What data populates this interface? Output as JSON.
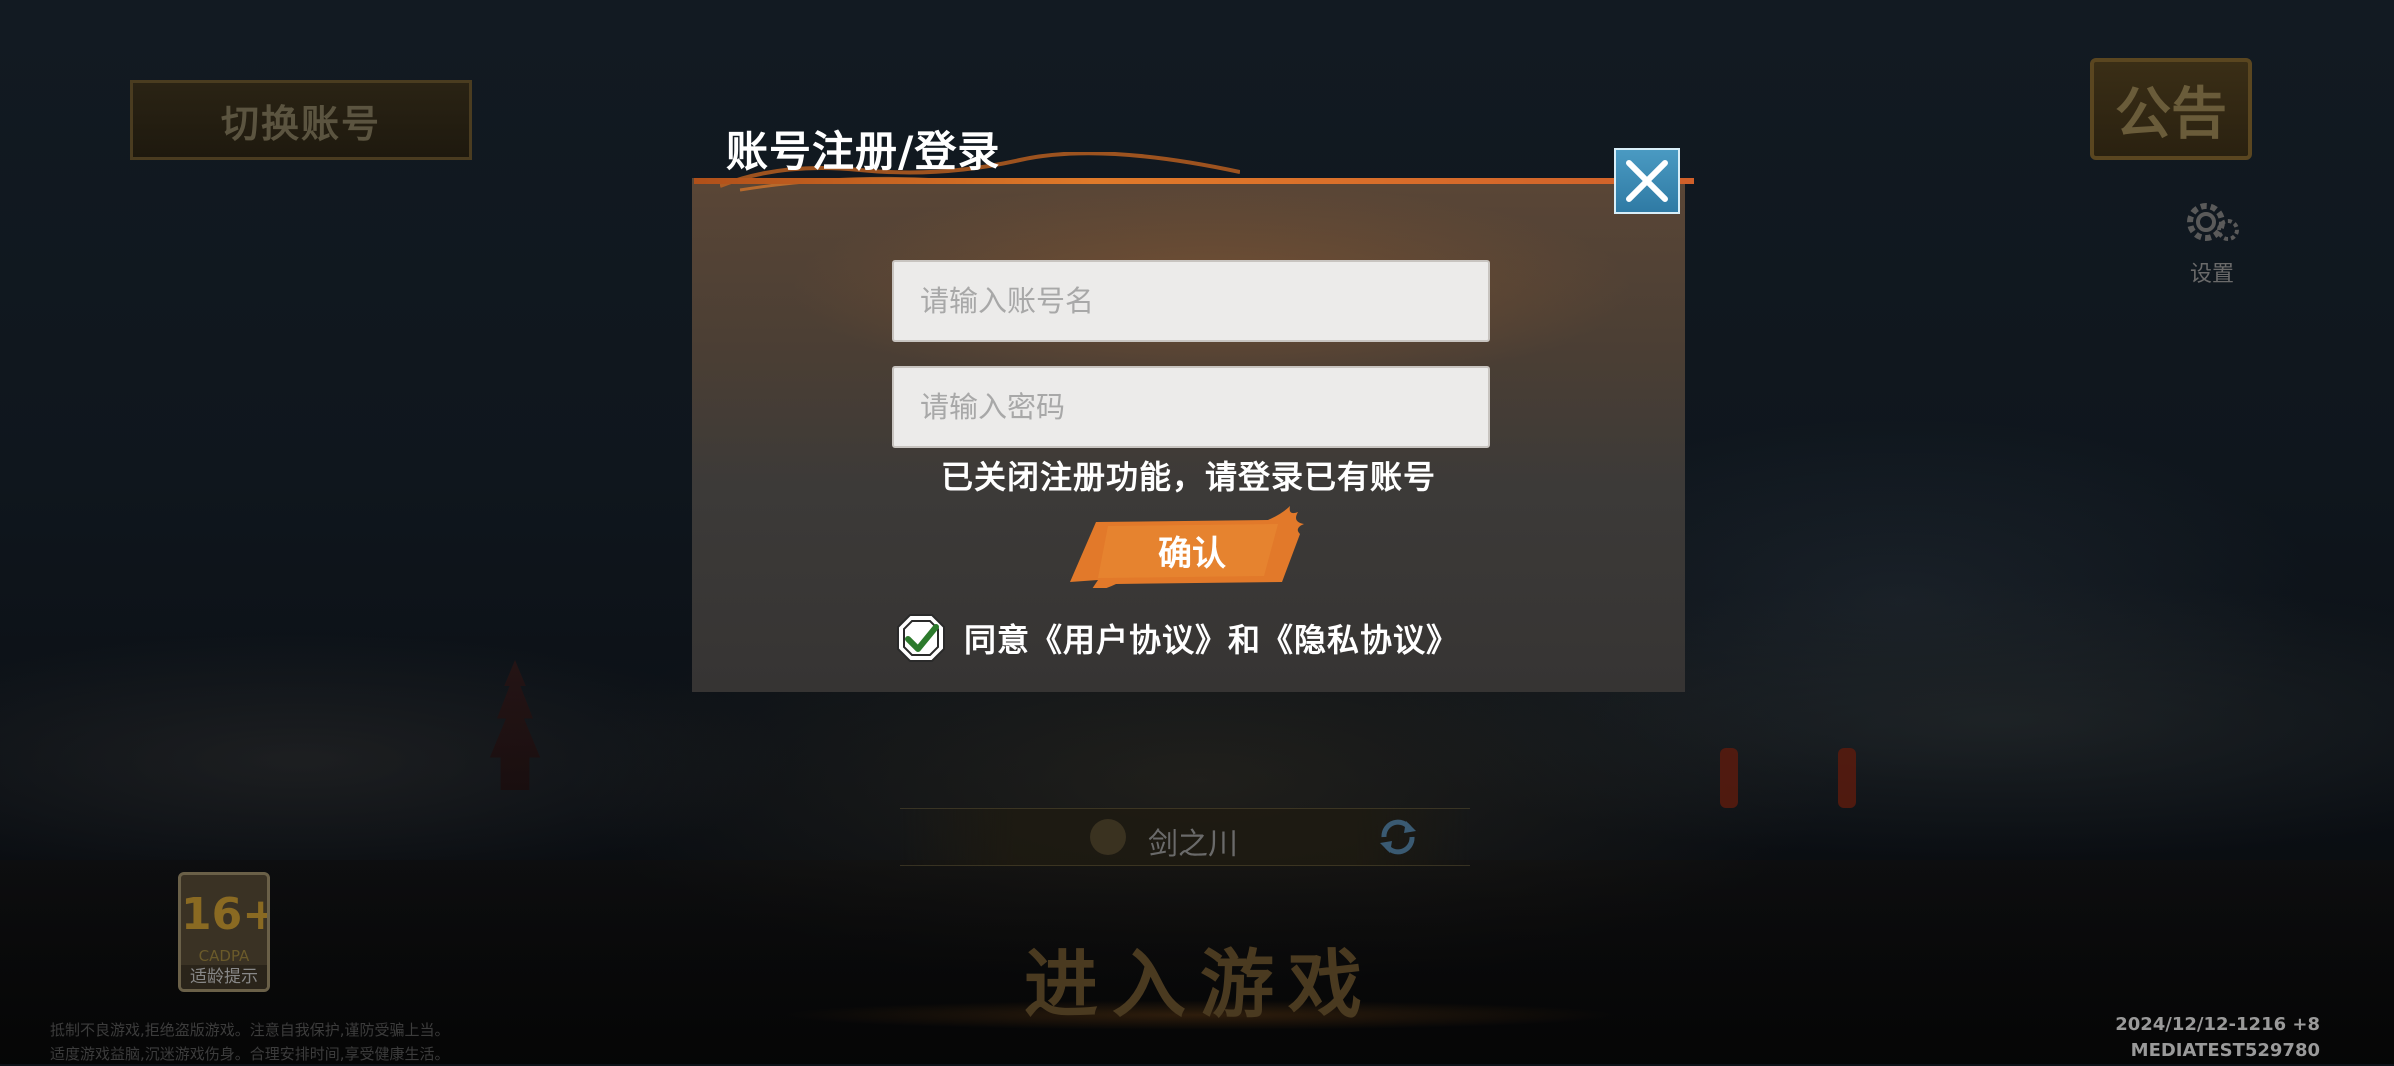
{
  "top_left": {
    "switch_account_label": "切换账号"
  },
  "top_right": {
    "notice_label": "公告",
    "settings_label": "设置"
  },
  "dialog": {
    "title": "账号注册/登录",
    "account_placeholder": "请输入账号名",
    "password_placeholder": "请输入密码",
    "hint": "已关闭注册功能，请登录已有账号",
    "confirm_label": "确认",
    "agree_text": "同意《用户协议》和《隐私协议》",
    "agree_checked": true
  },
  "server": {
    "name": "剑之川"
  },
  "enter_game_label": "进入游戏",
  "age_rating": {
    "number": "16+",
    "org": "CADPA",
    "tip": "适龄提示"
  },
  "disclaimer": {
    "line1": "抵制不良游戏,拒绝盗版游戏。注意自我保护,谨防受骗上当。",
    "line2": "适度游戏益脑,沉迷游戏伤身。合理安排时间,享受健康生活。"
  },
  "version": {
    "build": "2024/12/12-1216 +8",
    "device": "MEDIATEST529780"
  },
  "colors": {
    "accent_orange": "#e07a2a",
    "close_blue": "#3b8ab8",
    "dialog_bg": "#3c3a38"
  },
  "icons": [
    "close-icon",
    "gear-icon",
    "refresh-icon",
    "check-icon",
    "server-emblem-icon"
  ]
}
